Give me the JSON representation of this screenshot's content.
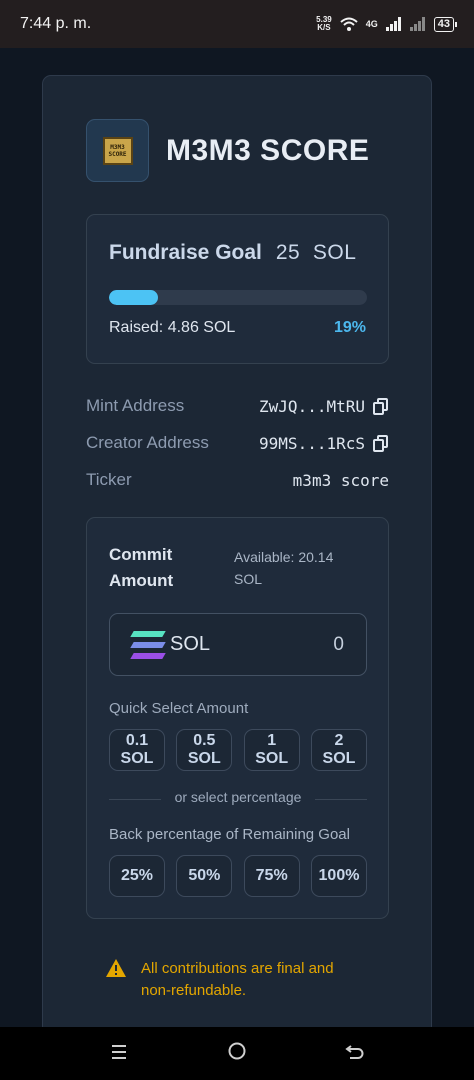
{
  "status_bar": {
    "time": "7:44 p. m.",
    "net_speed_top": "5.39",
    "net_speed_bottom": "K/S",
    "network": "4G",
    "battery": "43"
  },
  "app": {
    "logo_text_top": "M3M3",
    "logo_text_bottom": "SCORE",
    "title": "M3M3 SCORE"
  },
  "fundraise": {
    "label": "Fundraise Goal",
    "goal": "25  SOL",
    "raised_text": "Raised: 4.86 SOL",
    "percent_text": "19%",
    "progress_fraction": 0.19,
    "accent_color": "#4cc3f4"
  },
  "info": [
    {
      "label": "Mint Address",
      "value": "ZwJQ...MtRU",
      "has_copy": true
    },
    {
      "label": "Creator Address",
      "value": "99MS...1RcS",
      "has_copy": true
    },
    {
      "label": "Ticker",
      "value": "m3m3 score",
      "has_copy": false
    }
  ],
  "commit": {
    "title": "Commit Amount",
    "available": "Available: 20.14 SOL",
    "input_currency": "SOL",
    "input_value": "0",
    "quick_label": "Quick Select Amount",
    "quick_buttons": [
      "0.1\nSOL",
      "0.5\nSOL",
      "1\nSOL",
      "2\nSOL"
    ],
    "divider_text": "or select percentage",
    "percent_label": "Back percentage of Remaining Goal",
    "percent_buttons": [
      "25%",
      "50%",
      "75%",
      "100%"
    ]
  },
  "warning": {
    "text": "All contributions are final and non-refundable.",
    "color": "#e3a600"
  },
  "nav": {
    "menu_icon": "menu-icon",
    "home_icon": "home-icon",
    "back_icon": "back-icon"
  }
}
